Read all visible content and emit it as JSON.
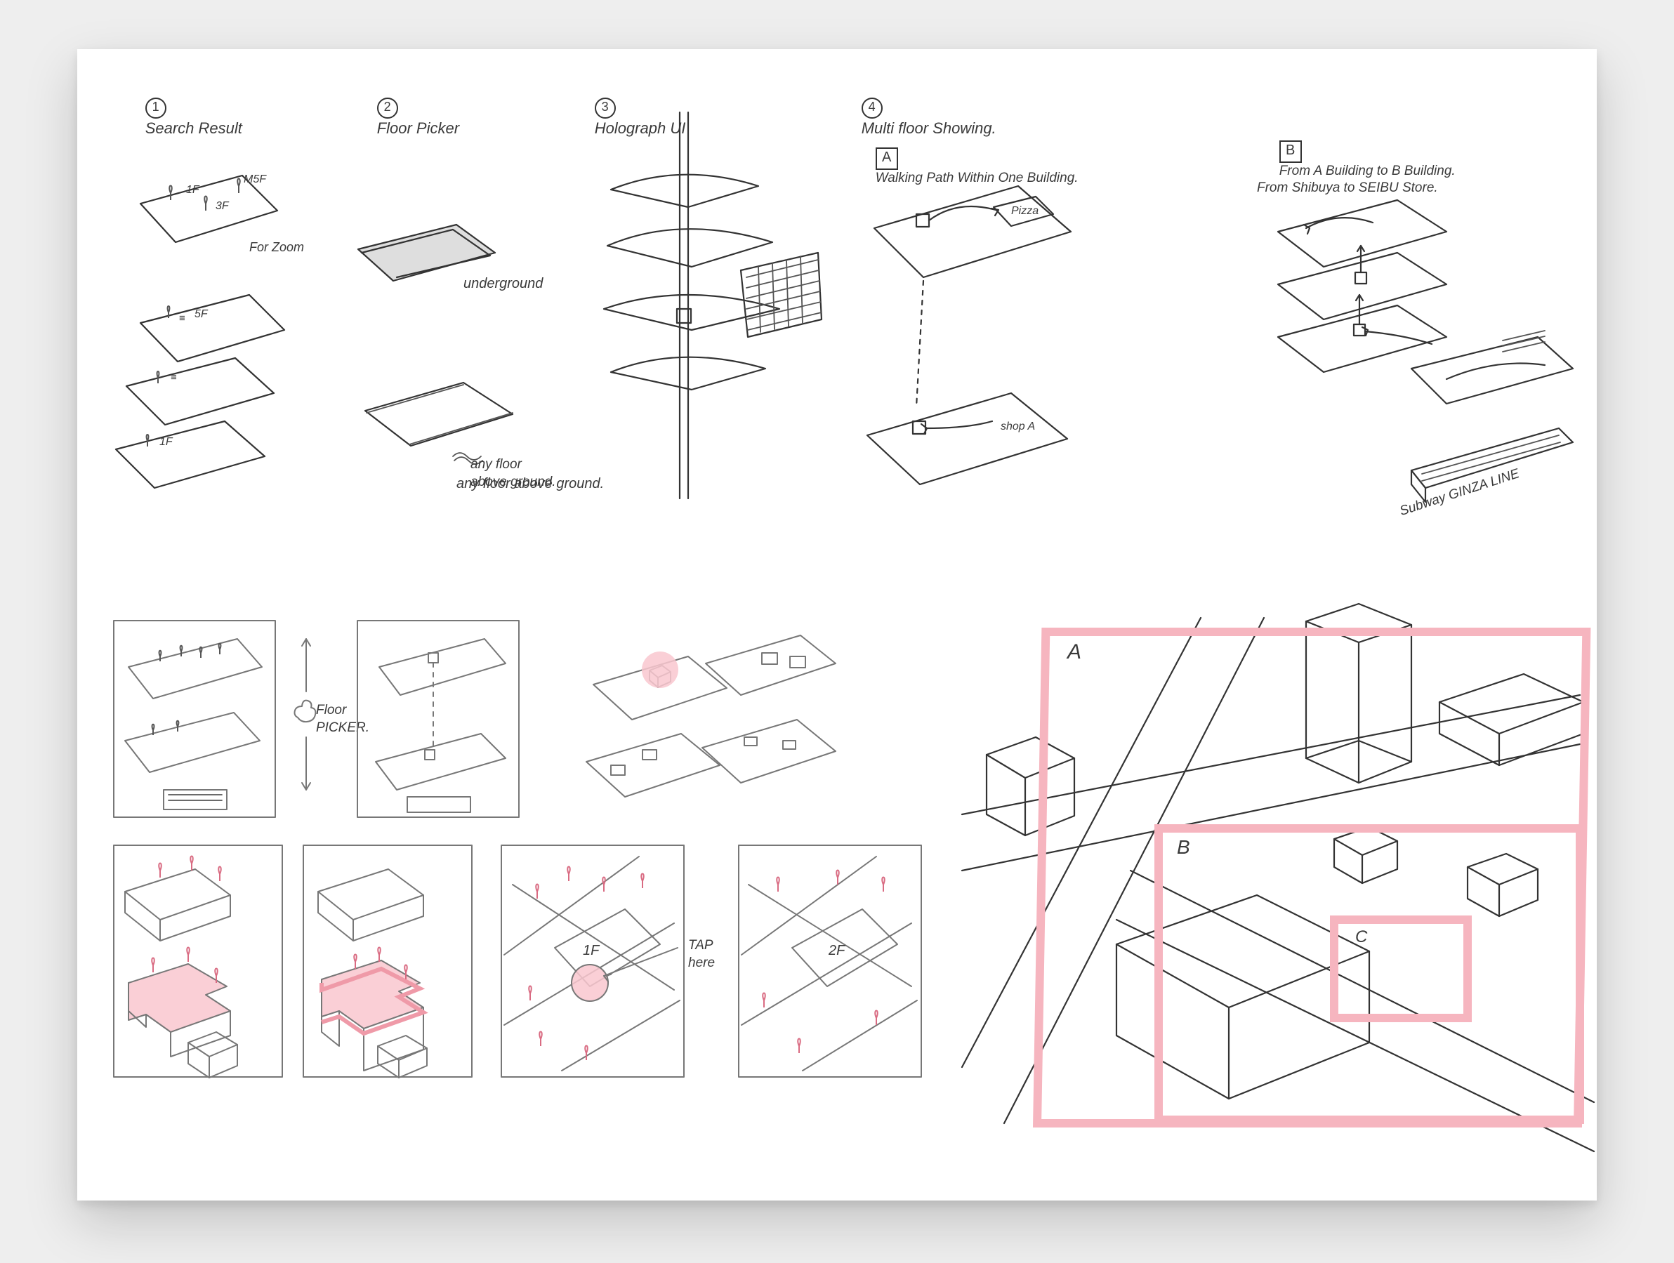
{
  "headings": {
    "h1_num": "1",
    "h1": "Search Result",
    "h2_num": "2",
    "h2": "Floor Picker",
    "h3_num": "3",
    "h3": "Holograph UI",
    "h4_num": "4",
    "h4": "Multi floor Showing."
  },
  "subheads": {
    "a_tag": "A",
    "a_text": "Walking Path Within One Building.",
    "b_tag": "B",
    "b_text": "From A Building to B Building.\nFrom Shibuya to SEIBU Store."
  },
  "col1": {
    "pin_top1": "1F",
    "pin_top2": "M5F",
    "pin_top3": "3F",
    "for_zoom": "For Zoom",
    "stack_top": "5F",
    "stack_bottom": "1F"
  },
  "col2": {
    "underground": "underground",
    "any_floor": "any floor\nabove ground."
  },
  "col4a": {
    "pizza": "Pizza",
    "shopA": "shop A"
  },
  "col4b": {
    "subway": "Subway GINZA LINE"
  },
  "row2": {
    "floor_picker": "Floor\nPICKER."
  },
  "row3": {
    "tile3_floor": "1F",
    "tile3_tap": "TAP\nhere",
    "tile4_floor": "2F"
  },
  "big": {
    "a": "A",
    "b": "B",
    "c": "C"
  }
}
